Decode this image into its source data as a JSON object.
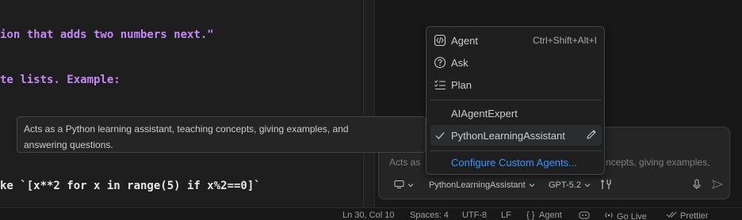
{
  "editor": {
    "lines": [
      "ion that adds two numbers next.\"",
      "te lists. Example:",
      "ke `[x**2 for x in range(5) if x%2==0]`"
    ]
  },
  "tooltip": {
    "text_line1": "Acts as a Python learning assistant, teaching concepts, giving examples, and",
    "text_line2": "answering questions."
  },
  "menu": {
    "items": [
      {
        "label": "Agent",
        "icon": "agent-icon",
        "shortcut": "Ctrl+Shift+Alt+I"
      },
      {
        "label": "Ask",
        "icon": "question-icon"
      },
      {
        "label": "Plan",
        "icon": "checklist-icon"
      }
    ],
    "custom_agents": [
      {
        "label": "AIAgentExpert"
      },
      {
        "label": "PythonLearningAssistant",
        "selected": true,
        "icon": "check-icon",
        "action_icon": "pencil-icon"
      }
    ],
    "configure_label": "Configure Custom Agents..."
  },
  "chat": {
    "placeholder_left": "Acts as",
    "placeholder_right": "ncepts, giving examples,",
    "toolbar": {
      "agent_label": "PythonLearningAssistant",
      "model_label": "GPT-5.2"
    }
  },
  "statusbar": {
    "position": "Ln 30, Col 10",
    "spaces": "Spaces: 4",
    "encoding": "UTF-8",
    "eol": "LF",
    "language": "{ }",
    "agent": "Agent",
    "golive": "Go Live",
    "prettier": "Prettier"
  },
  "colors": {
    "code_purple": "#c586f6",
    "link_blue": "#3794ff",
    "background": "#1e1e1e"
  }
}
